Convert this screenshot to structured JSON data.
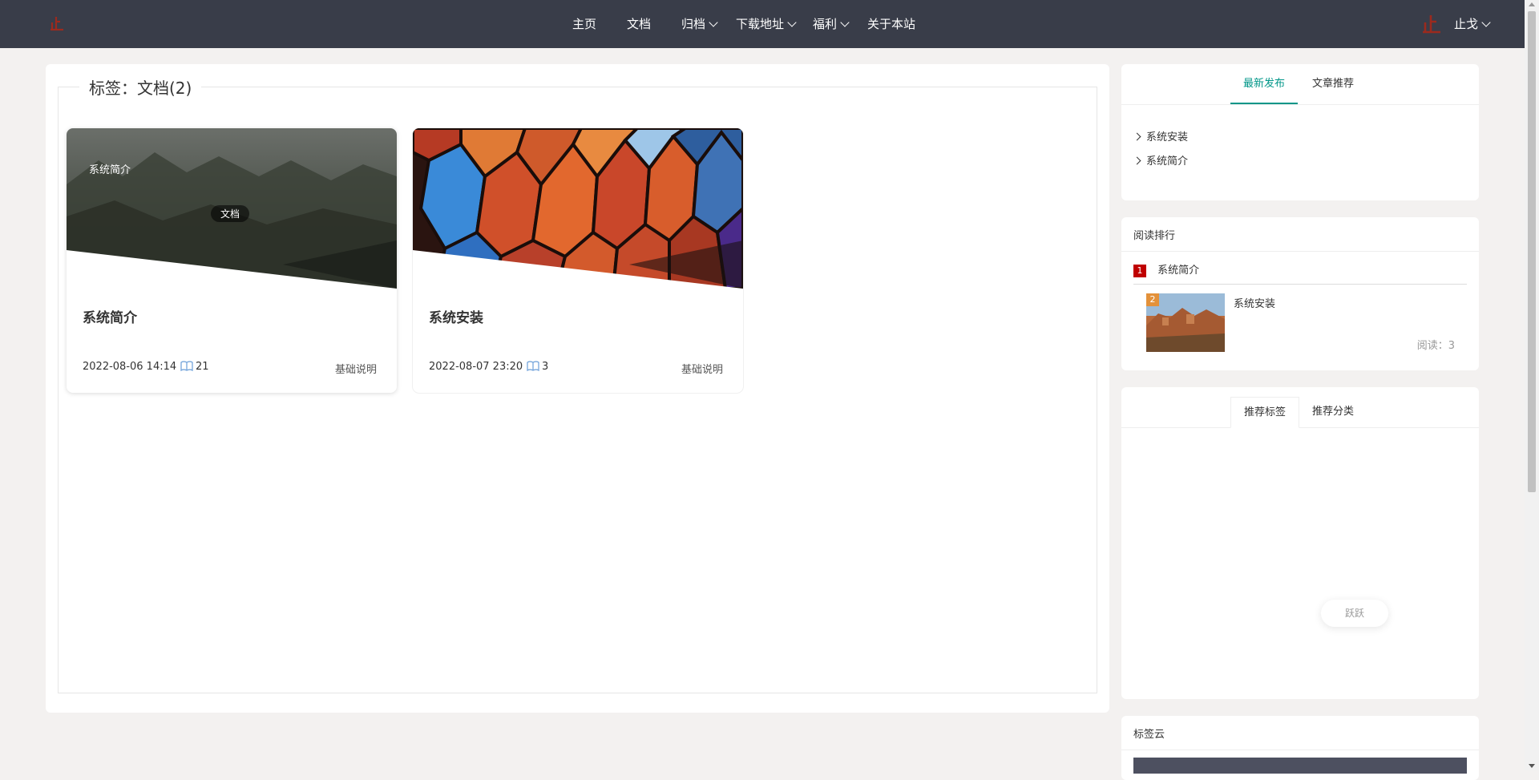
{
  "nav": {
    "items": [
      {
        "label": "主页",
        "dropdown": false
      },
      {
        "label": "文档",
        "dropdown": false
      },
      {
        "label": "归档",
        "dropdown": true
      },
      {
        "label": "下载地址",
        "dropdown": true
      },
      {
        "label": "福利",
        "dropdown": true
      },
      {
        "label": "关于本站",
        "dropdown": false
      }
    ],
    "user": "止戈"
  },
  "main": {
    "legend": "标签：文档(2)",
    "cards": [
      {
        "title": "系统简介",
        "date": "2022-08-06 14:14",
        "reads": "21",
        "category": "基础说明",
        "overlay_label": "系统简介",
        "overlay_tag": "文档"
      },
      {
        "title": "系统安装",
        "date": "2022-08-07 23:20",
        "reads": "3",
        "category": "基础说明"
      }
    ]
  },
  "sidebar": {
    "posts_tabs": [
      "最新发布",
      "文章推荐"
    ],
    "latest_posts": [
      "系统安装",
      "系统简介"
    ],
    "reading_rank": {
      "title": "阅读排行",
      "items": [
        {
          "rank": "1",
          "title": "系统简介"
        },
        {
          "rank": "2",
          "title": "系统安装",
          "reads": "阅读：3"
        }
      ]
    },
    "rec_tabs": [
      "推荐标签",
      "推荐分类"
    ],
    "loading_label": "跃跃",
    "tag_cloud_title": "标签云"
  },
  "colors": {
    "nav_bg": "#393d49",
    "accent": "#009688",
    "rank1": "#c00000",
    "rank2": "#e3913a"
  }
}
